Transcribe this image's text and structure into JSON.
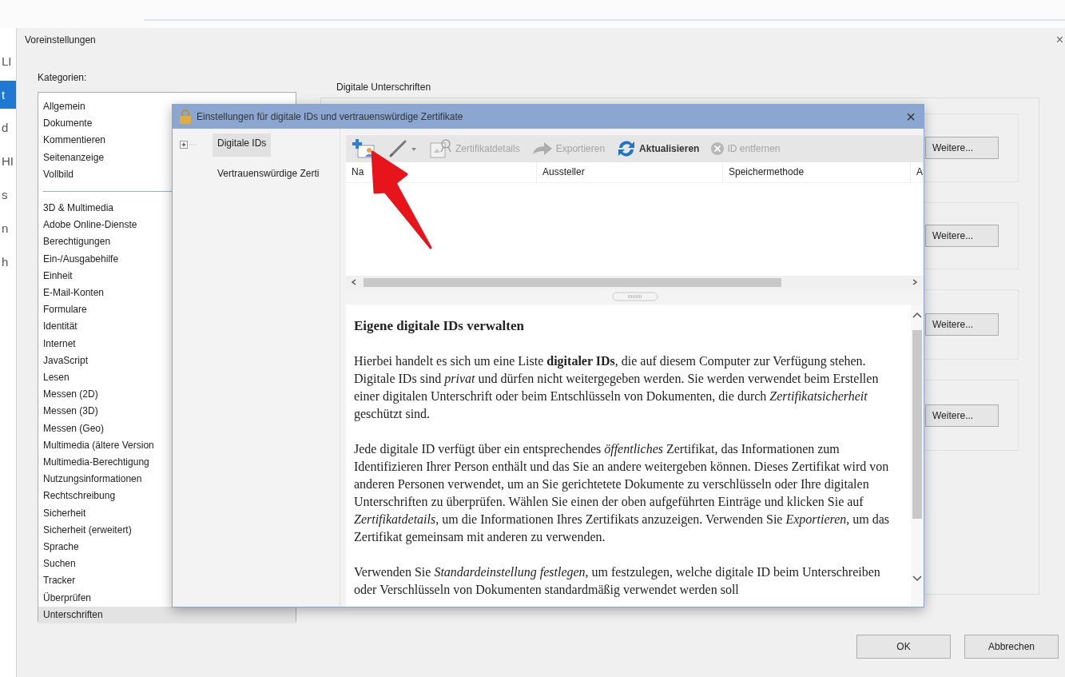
{
  "background_app": {
    "fragments": [
      {
        "text": "LI",
        "selected": false
      },
      {
        "text": "t",
        "selected": true
      },
      {
        "text": "d",
        "selected": false
      },
      {
        "text": "HI",
        "selected": false
      },
      {
        "text": "s",
        "selected": false
      },
      {
        "text": "n",
        "selected": false
      },
      {
        "text": "h",
        "selected": false
      }
    ]
  },
  "preferences_dialog": {
    "title": "Voreinstellungen",
    "close": "×",
    "categories_label": "Kategorien:",
    "categories_top": [
      {
        "label": "Allgemein",
        "selected": false
      },
      {
        "label": "Dokumente",
        "selected": false
      },
      {
        "label": "Kommentieren",
        "selected": false
      },
      {
        "label": "Seitenanzeige",
        "selected": false
      },
      {
        "label": "Vollbild",
        "selected": false
      }
    ],
    "categories_bottom": [
      {
        "label": "3D & Multimedia",
        "selected": false
      },
      {
        "label": "Adobe Online-Dienste",
        "selected": false
      },
      {
        "label": "Berechtigungen",
        "selected": false
      },
      {
        "label": "Ein-/Ausgabehilfe",
        "selected": false
      },
      {
        "label": "Einheit",
        "selected": false
      },
      {
        "label": "E-Mail-Konten",
        "selected": false
      },
      {
        "label": "Formulare",
        "selected": false
      },
      {
        "label": "Identität",
        "selected": false
      },
      {
        "label": "Internet",
        "selected": false
      },
      {
        "label": "JavaScript",
        "selected": false
      },
      {
        "label": "Lesen",
        "selected": false
      },
      {
        "label": "Messen (2D)",
        "selected": false
      },
      {
        "label": "Messen (3D)",
        "selected": false
      },
      {
        "label": "Messen (Geo)",
        "selected": false
      },
      {
        "label": "Multimedia (ältere Version",
        "selected": false
      },
      {
        "label": "Multimedia-Berechtigung",
        "selected": false
      },
      {
        "label": "Nutzungsinformationen",
        "selected": false
      },
      {
        "label": "Rechtschreibung",
        "selected": false
      },
      {
        "label": "Sicherheit",
        "selected": false
      },
      {
        "label": "Sicherheit (erweitert)",
        "selected": false
      },
      {
        "label": "Sprache",
        "selected": false
      },
      {
        "label": "Suchen",
        "selected": false
      },
      {
        "label": "Tracker",
        "selected": false
      },
      {
        "label": "Überprüfen",
        "selected": false
      },
      {
        "label": "Unterschriften",
        "selected": true
      }
    ],
    "group_title": "Digitale Unterschriften",
    "more_buttons": [
      "Weitere...",
      "Weitere...",
      "Weitere...",
      "Weitere..."
    ],
    "buttons": [
      "OK",
      "Abbrechen"
    ]
  },
  "certificate_dialog": {
    "title": "Einstellungen für digitale IDs und vertrauenswürdige Zertifikate",
    "close": "×",
    "tree": [
      {
        "label": "Digitale IDs",
        "selected": true,
        "expandable": true
      },
      {
        "label": "Vertrauenswürdige Zerti",
        "selected": false,
        "expandable": false
      }
    ],
    "toolbar": [
      {
        "kind": "add-id",
        "disabled": false
      },
      {
        "kind": "pen",
        "disabled": false
      },
      {
        "kind": "details",
        "label": "Zertifikatdetails",
        "disabled": true
      },
      {
        "kind": "export",
        "label": "Exportieren",
        "disabled": true
      },
      {
        "kind": "refresh",
        "label": "Aktualisieren",
        "disabled": false
      },
      {
        "kind": "remove",
        "label": "ID entfernen",
        "disabled": true
      }
    ],
    "columns": [
      "Na",
      "Aussteller",
      "Speichermethode",
      "A"
    ],
    "help": {
      "heading": "Eigene digitale IDs verwalten",
      "paragraphs": [
        "Hierbei handelt es sich um eine Liste **digitaler IDs**, die auf diesem Computer zur Verfügung stehen. Digitale IDs sind *privat* und dürfen nicht weitergegeben werden. Sie werden verwendet beim Erstellen einer digitalen Unterschrift oder beim Entschlüsseln von Dokumenten, die durch *Zertifikatsicherheit* geschützt sind.",
        "Jede digitale ID verfügt über ein entsprechendes *öffentliches* Zertifikat, das Informationen zum Identifizieren Ihrer Person enthält und das Sie an andere weitergeben können. Dieses Zertifikat wird von anderen Personen verwendet, um an Sie gerichtetete Dokumente zu verschlüsseln oder Ihre digitalen Unterschriften zu überprüfen. Wählen Sie einen der oben aufgeführten Einträge und klicken Sie auf *Zertifikatdetails*, um die Informationen Ihres Zertifikats anzuzeigen. Verwenden Sie *Exportieren*, um das Zertifikat gemeinsam mit anderen zu verwenden.",
        "Verwenden Sie *Standardeinstellung festlegen*, um festzulegen, welche digitale ID beim Unterschreiben oder Verschlüsseln von Dokumenten standardmäßig verwendet werden soll"
      ]
    }
  }
}
